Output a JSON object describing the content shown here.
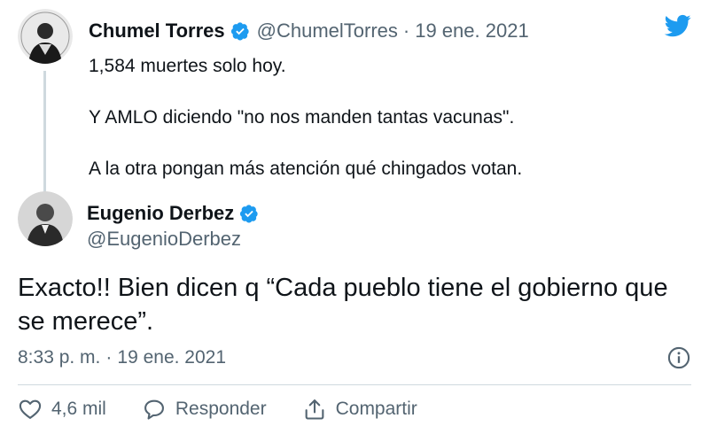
{
  "parent_tweet": {
    "name": "Chumel Torres",
    "handle": "@ChumelTorres",
    "date": "19 ene. 2021",
    "lines": [
      "1,584 muertes solo hoy.",
      "Y AMLO diciendo \"no nos manden tantas vacunas\".",
      "A la otra pongan más atención qué chingados votan."
    ],
    "separator": "·"
  },
  "reply_tweet": {
    "name": "Eugenio Derbez",
    "handle": "@EugenioDerbez",
    "text": "Exacto!! Bien dicen q “Cada pueblo tiene el gobierno que se merece”.",
    "time": "8:33 p. m.",
    "separator": "·",
    "date": "19 ene. 2021"
  },
  "actions": {
    "like_count": "4,6 mil",
    "reply_label": "Responder",
    "share_label": "Compartir"
  },
  "colors": {
    "twitter_blue": "#1d9bf0",
    "text": "#0f1419",
    "secondary": "#536471",
    "divider": "#cfd9de"
  },
  "icons": {
    "brand": "twitter-bird-icon",
    "verified": "verified-badge-icon",
    "info": "info-icon",
    "like": "heart-icon",
    "reply": "speech-bubble-icon",
    "share": "share-icon"
  }
}
